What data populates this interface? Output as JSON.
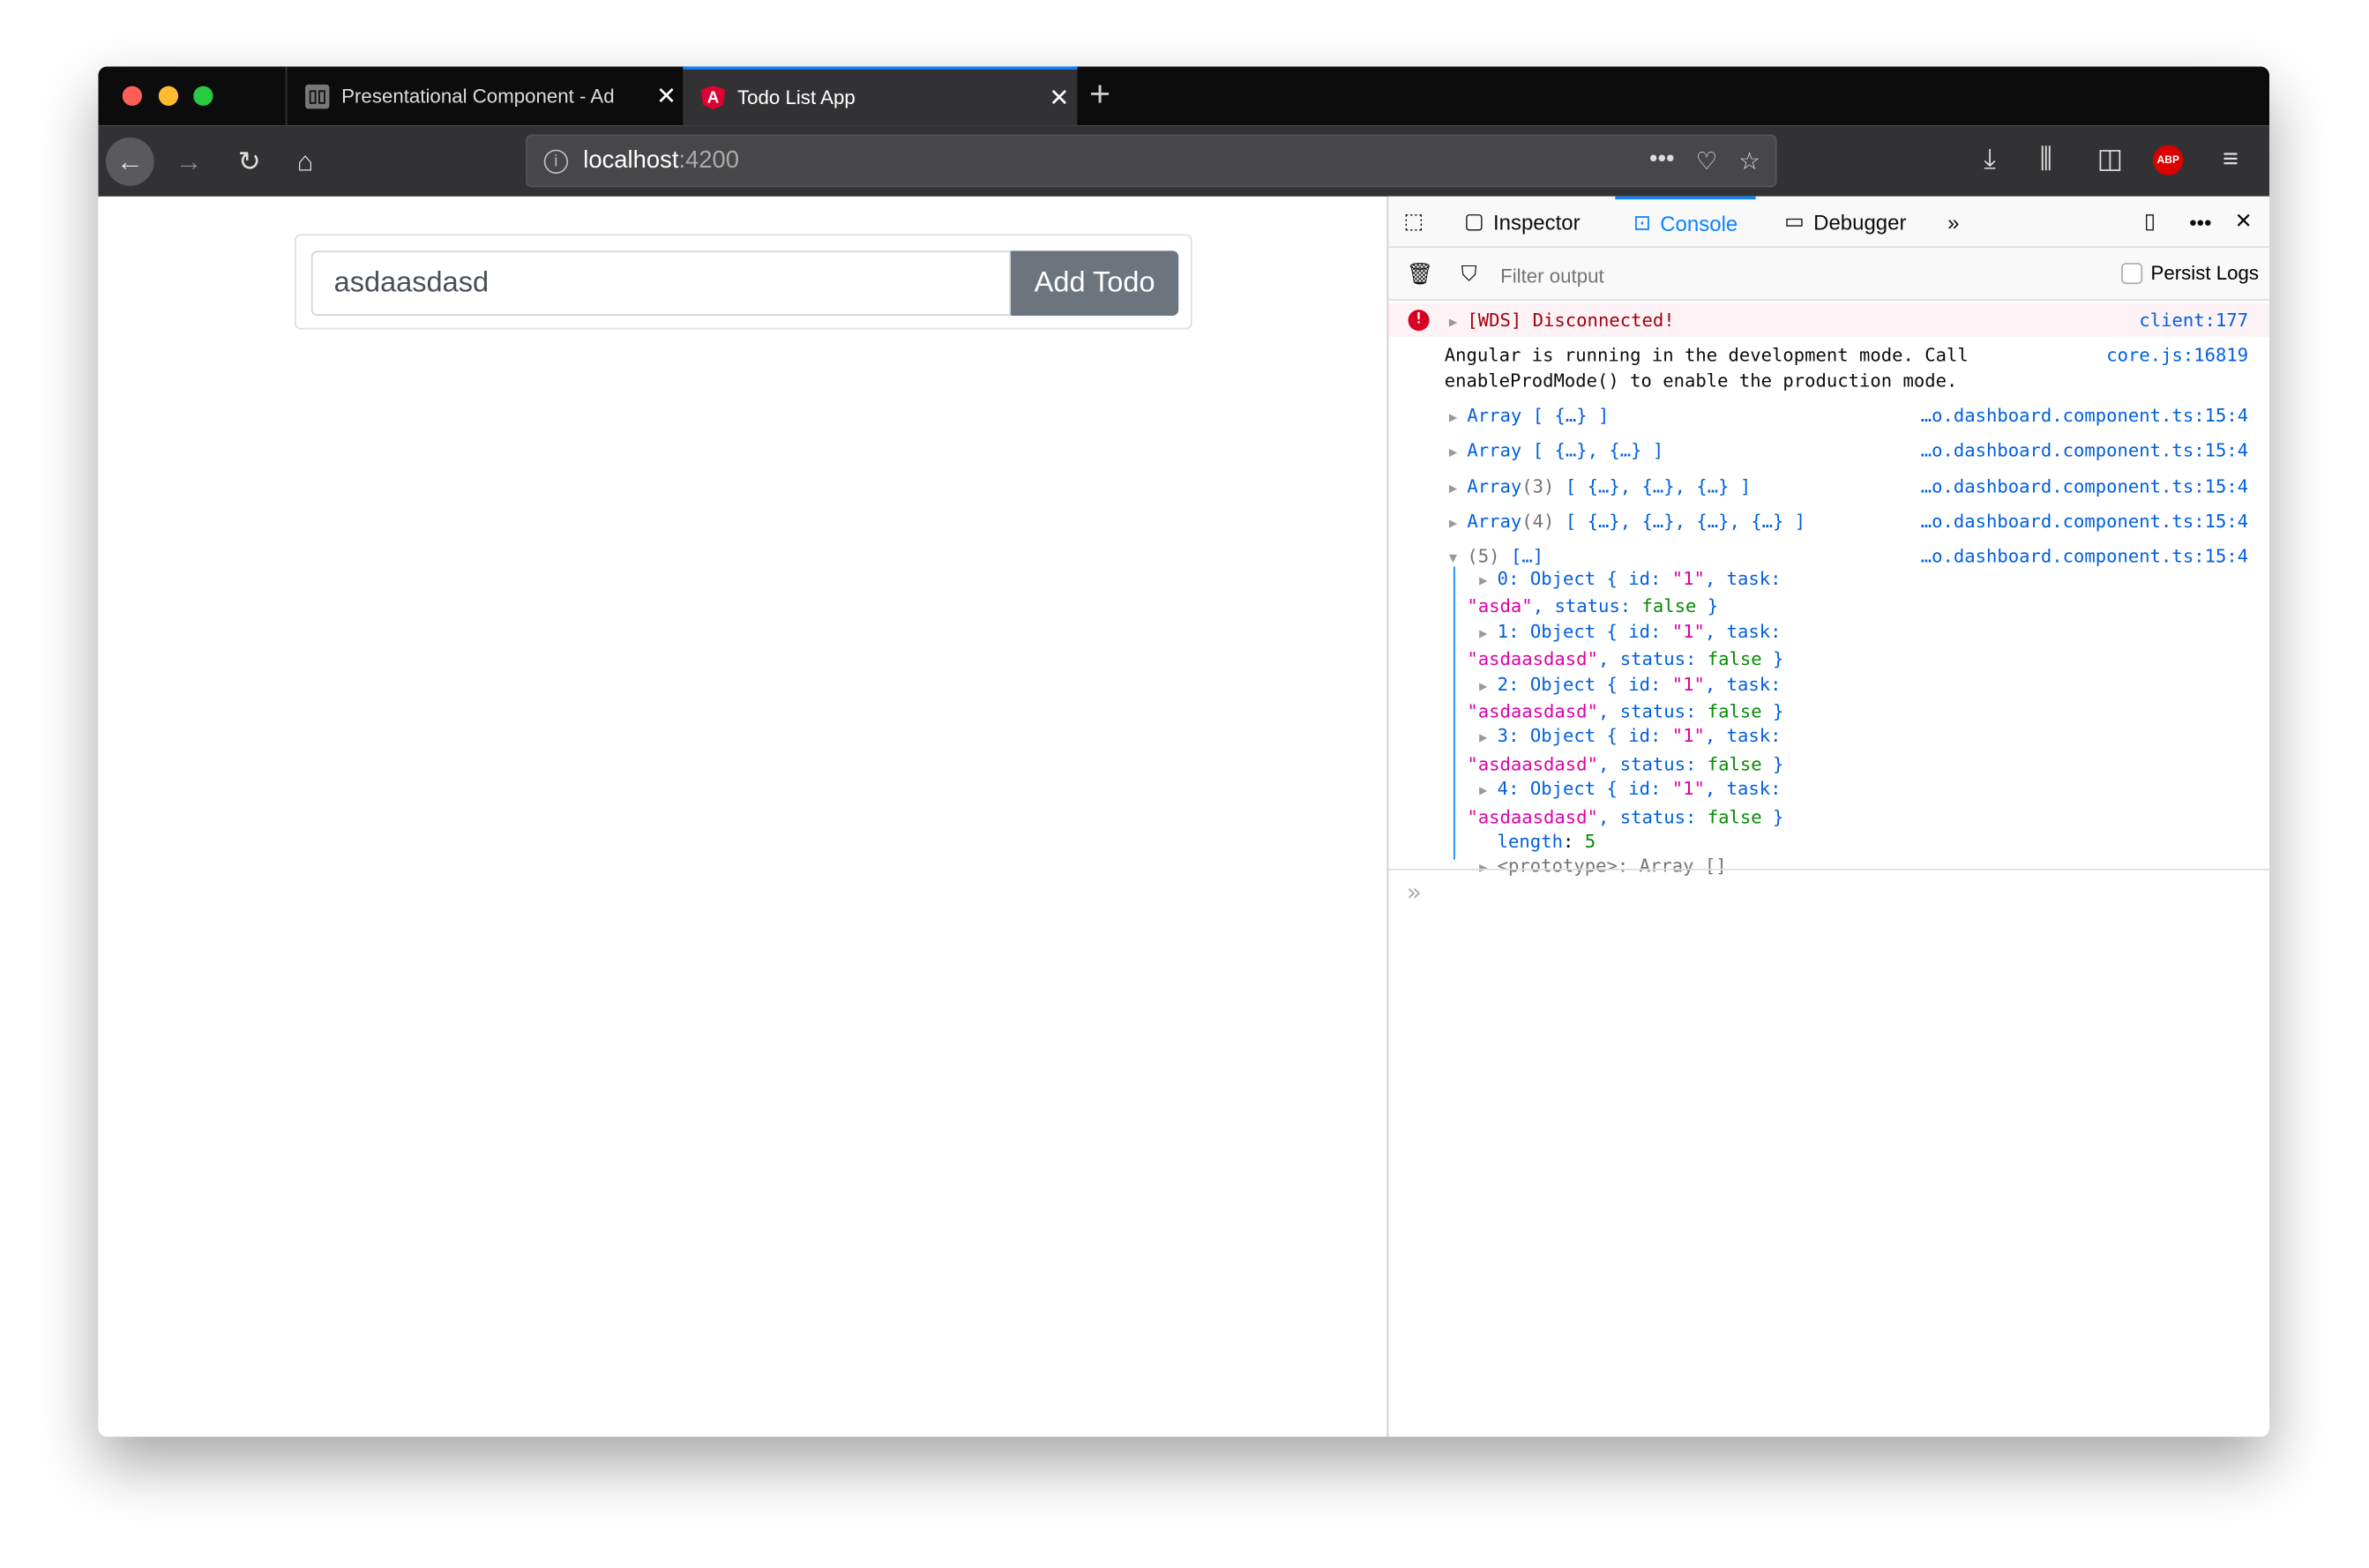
{
  "browser": {
    "tabs": [
      {
        "title": "Presentational Component - Ad",
        "icon": "book-icon",
        "active": false
      },
      {
        "title": "Todo List App",
        "icon": "angular-icon",
        "active": true
      }
    ],
    "url_host": "localhost",
    "url_port": ":4200",
    "abp_label": "ABP",
    "colors": {
      "tabbar": "#0c0c0d",
      "toolbar": "#323234",
      "accent": "#0a84ff"
    }
  },
  "page": {
    "input_value": "asdaasdasd",
    "add_button": "Add Todo"
  },
  "devtools": {
    "tabs": [
      "Inspector",
      "Console",
      "Debugger"
    ],
    "active_tab": "Console",
    "filter_placeholder": "Filter output",
    "persist_logs": "Persist Logs",
    "error": {
      "text": "[WDS] Disconnected!",
      "source": "client:177"
    },
    "info": {
      "line1": "Angular is running in the development mode. Call",
      "line2": "enableProdMode() to enable the production mode.",
      "source": "core.js:16819"
    },
    "arrays": [
      {
        "head": "Array",
        "count": "",
        "items": "[ {…} ]",
        "source": "…o.dashboard.component.ts:15:4"
      },
      {
        "head": "Array",
        "count": "",
        "items": "[ {…}, {…} ]",
        "source": "…o.dashboard.component.ts:15:4"
      },
      {
        "head": "Array",
        "count": "(3)",
        "items": "[ {…}, {…}, {…} ]",
        "source": "…o.dashboard.component.ts:15:4"
      },
      {
        "head": "Array",
        "count": "(4)",
        "items": "[ {…}, {…}, {…}, {…} ]",
        "source": "…o.dashboard.component.ts:15:4"
      }
    ],
    "expanded": {
      "head": "(5)",
      "items": "[…]",
      "source": "…o.dashboard.component.ts:15:4",
      "objects": [
        {
          "index": "0",
          "id": "\"1\"",
          "task": "\"asda\"",
          "status": "false"
        },
        {
          "index": "1",
          "id": "\"1\"",
          "task": "\"asdaasdasd\"",
          "status": "false"
        },
        {
          "index": "2",
          "id": "\"1\"",
          "task": "\"asdaasdasd\"",
          "status": "false"
        },
        {
          "index": "3",
          "id": "\"1\"",
          "task": "\"asdaasdasd\"",
          "status": "false"
        },
        {
          "index": "4",
          "id": "\"1\"",
          "task": "\"asdaasdasd\"",
          "status": "false"
        }
      ],
      "length_label": "length",
      "length": "5",
      "prototype": "<prototype>: Array []"
    },
    "prompt": "»"
  }
}
